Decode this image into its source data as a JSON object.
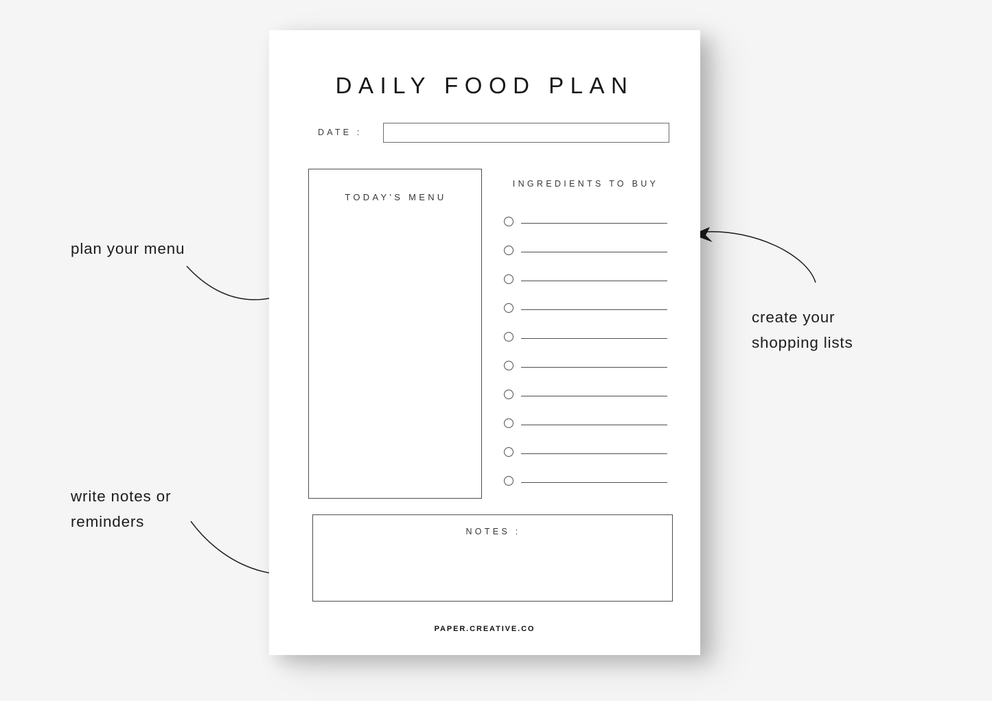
{
  "page": {
    "background_color": "#f5f5f5",
    "sheet_color": "#ffffff"
  },
  "sheet": {
    "title": "DAILY FOOD PLAN",
    "date": {
      "label": "DATE :",
      "value": "",
      "placeholder": ""
    },
    "menu": {
      "title": "TODAY'S MENU",
      "value": ""
    },
    "ingredients": {
      "title": "INGREDIENTS TO BUY",
      "items": [
        {
          "checked": false,
          "text": ""
        },
        {
          "checked": false,
          "text": ""
        },
        {
          "checked": false,
          "text": ""
        },
        {
          "checked": false,
          "text": ""
        },
        {
          "checked": false,
          "text": ""
        },
        {
          "checked": false,
          "text": ""
        },
        {
          "checked": false,
          "text": ""
        },
        {
          "checked": false,
          "text": ""
        },
        {
          "checked": false,
          "text": ""
        },
        {
          "checked": false,
          "text": ""
        }
      ]
    },
    "notes": {
      "title": "NOTES :",
      "value": ""
    },
    "footer": "PAPER.CREATIVE.CO"
  },
  "annotations": {
    "menu": "plan your menu",
    "notes": "write notes or\nreminders",
    "shopping": "create your\nshopping lists"
  },
  "colors": {
    "ink": "#1b1c1e",
    "rule": "#4d4f52",
    "muted": "#35373a"
  }
}
